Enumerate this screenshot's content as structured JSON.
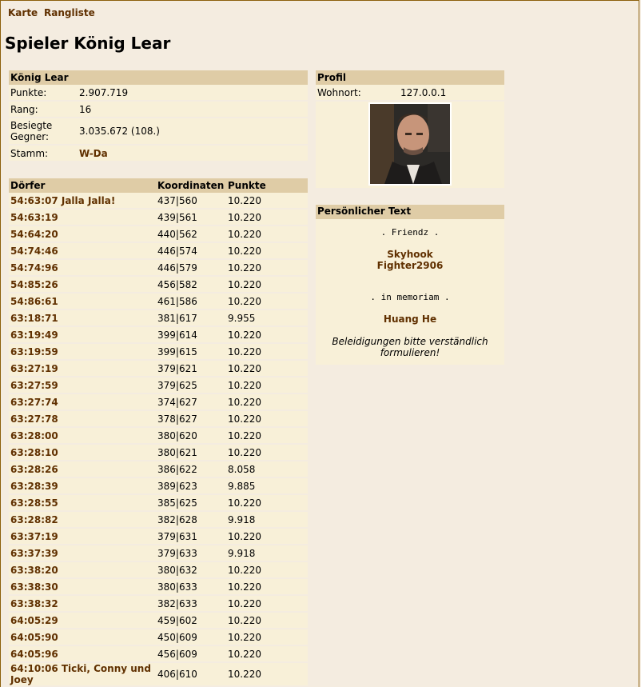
{
  "nav": {
    "map": "Karte",
    "ranking": "Rangliste"
  },
  "page_title": "Spieler König Lear",
  "player": {
    "name": "König Lear",
    "rows": [
      {
        "label": "Punkte:",
        "value": "2.907.719"
      },
      {
        "label": "Rang:",
        "value": "16"
      },
      {
        "label": "Besiegte Gegner:",
        "value": "3.035.672 (108.)"
      },
      {
        "label": "Stamm:",
        "value": "W-Da"
      }
    ]
  },
  "villages": {
    "headers": {
      "name": "Dörfer",
      "coords": "Koordinaten",
      "points": "Punkte"
    },
    "rows": [
      {
        "name": "54:63:07 Jalla Jalla!",
        "coords": "437|560",
        "points": "10.220"
      },
      {
        "name": "54:63:19",
        "coords": "439|561",
        "points": "10.220"
      },
      {
        "name": "54:64:20",
        "coords": "440|562",
        "points": "10.220"
      },
      {
        "name": "54:74:46",
        "coords": "446|574",
        "points": "10.220"
      },
      {
        "name": "54:74:96",
        "coords": "446|579",
        "points": "10.220"
      },
      {
        "name": "54:85:26",
        "coords": "456|582",
        "points": "10.220"
      },
      {
        "name": "54:86:61",
        "coords": "461|586",
        "points": "10.220"
      },
      {
        "name": "63:18:71",
        "coords": "381|617",
        "points": "9.955"
      },
      {
        "name": "63:19:49",
        "coords": "399|614",
        "points": "10.220"
      },
      {
        "name": "63:19:59",
        "coords": "399|615",
        "points": "10.220"
      },
      {
        "name": "63:27:19",
        "coords": "379|621",
        "points": "10.220"
      },
      {
        "name": "63:27:59",
        "coords": "379|625",
        "points": "10.220"
      },
      {
        "name": "63:27:74",
        "coords": "374|627",
        "points": "10.220"
      },
      {
        "name": "63:27:78",
        "coords": "378|627",
        "points": "10.220"
      },
      {
        "name": "63:28:00",
        "coords": "380|620",
        "points": "10.220"
      },
      {
        "name": "63:28:10",
        "coords": "380|621",
        "points": "10.220"
      },
      {
        "name": "63:28:26",
        "coords": "386|622",
        "points": "8.058"
      },
      {
        "name": "63:28:39",
        "coords": "389|623",
        "points": "9.885"
      },
      {
        "name": "63:28:55",
        "coords": "385|625",
        "points": "10.220"
      },
      {
        "name": "63:28:82",
        "coords": "382|628",
        "points": "9.918"
      },
      {
        "name": "63:37:19",
        "coords": "379|631",
        "points": "10.220"
      },
      {
        "name": "63:37:39",
        "coords": "379|633",
        "points": "9.918"
      },
      {
        "name": "63:38:20",
        "coords": "380|632",
        "points": "10.220"
      },
      {
        "name": "63:38:30",
        "coords": "380|633",
        "points": "10.220"
      },
      {
        "name": "63:38:32",
        "coords": "382|633",
        "points": "10.220"
      },
      {
        "name": "64:05:29",
        "coords": "459|602",
        "points": "10.220"
      },
      {
        "name": "64:05:90",
        "coords": "450|609",
        "points": "10.220"
      },
      {
        "name": "64:05:96",
        "coords": "456|609",
        "points": "10.220"
      },
      {
        "name": "64:10:06 Ticki, Conny und Joey",
        "coords": "406|610",
        "points": "10.220"
      }
    ]
  },
  "profile": {
    "header": "Profil",
    "location_label": "Wohnort:",
    "location_value": "127.0.0.1"
  },
  "personal_text": {
    "header": "Persönlicher Text",
    "friends_line": ". Friendz .",
    "friend_1": "Skyhook",
    "friend_2": "Fighter2906",
    "memoriam_line": ". in memoriam .",
    "memoriam_name": "Huang He",
    "disclaimer": "Beleidigungen bitte verständlich formulieren!"
  }
}
